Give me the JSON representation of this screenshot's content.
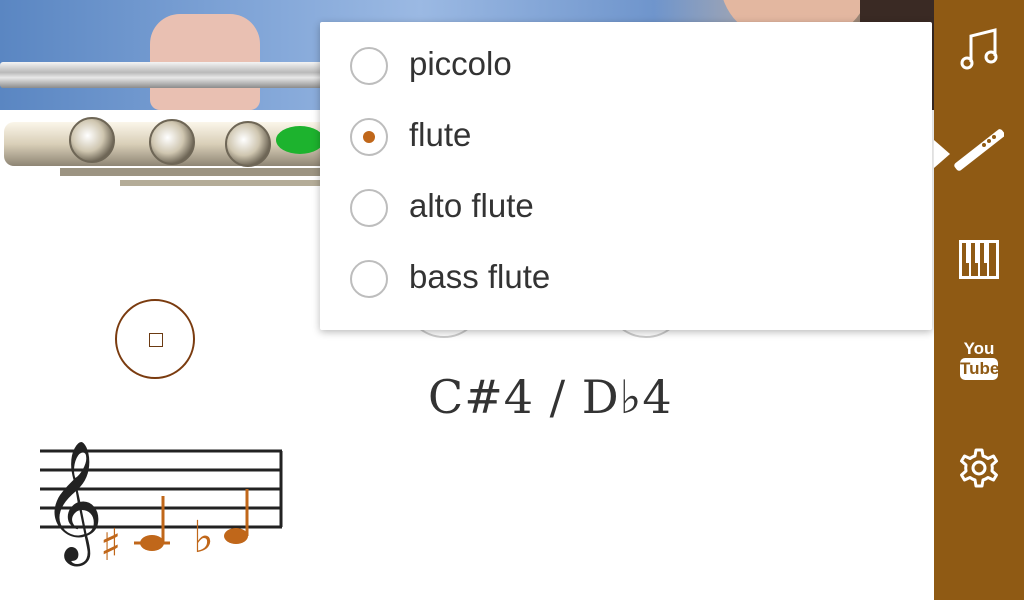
{
  "colors": {
    "sidebar": "#8f5a14",
    "accent": "#c0671a",
    "stop_border": "#7a3b0f",
    "note_text": "#333333"
  },
  "note": {
    "name": "C#4 / D♭4"
  },
  "instrument_menu": {
    "selected": "flute",
    "items": [
      {
        "label": "piccolo",
        "checked": false
      },
      {
        "label": "flute",
        "checked": true
      },
      {
        "label": "alto flute",
        "checked": false
      },
      {
        "label": "bass flute",
        "checked": false
      }
    ]
  },
  "sidebar": {
    "items": [
      {
        "icon": "music-notes-icon",
        "active": false
      },
      {
        "icon": "flute-icon",
        "active": true
      },
      {
        "icon": "piano-keyboard-icon",
        "active": false
      },
      {
        "icon": "youtube-icon",
        "active": false
      },
      {
        "icon": "gear-icon",
        "active": false
      }
    ],
    "youtube_text": [
      "You",
      "Tube"
    ]
  },
  "staff": {
    "clef": "treble-clef",
    "notes": [
      {
        "accidental": "sharp",
        "pitch": "C4"
      },
      {
        "accidental": "flat",
        "pitch": "D4"
      }
    ],
    "glyphs": {
      "clef": "𝄞",
      "sharp": "♯",
      "flat": "♭"
    }
  },
  "stop_button": {
    "icon": "stop-icon"
  }
}
